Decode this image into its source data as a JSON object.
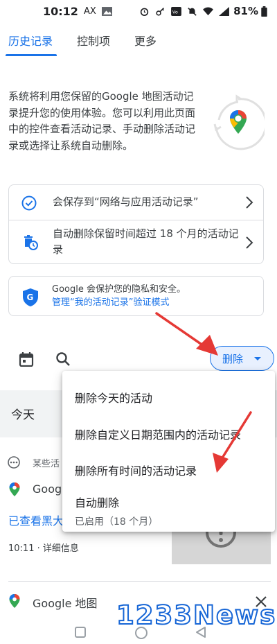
{
  "status_bar": {
    "time": "10:12",
    "ax_label": "AX",
    "battery": "81%"
  },
  "tabs": [
    {
      "label": "历史记录",
      "active": true
    },
    {
      "label": "控制项",
      "active": false
    },
    {
      "label": "更多",
      "active": false
    }
  ],
  "intro": {
    "text": "系统将利用您保留的Google 地图活动记录提升您的使用体验。您可以利用此页面中的控件查看活动记录、手动删除活动记录或选择让系统自动删除。"
  },
  "settings_card": {
    "saving_text": "会保存到“网络与应用活动记录”",
    "auto_delete_text": "自动删除保留时间超过 18 个月的活动记录"
  },
  "privacy": {
    "text": "Google 会保护您的隐私和安全。",
    "link": "管理“我的活动记录”验证模式"
  },
  "toolbar": {
    "delete_label": "删除"
  },
  "feed": {
    "today_label": "今天",
    "item_caption": "某些活",
    "app_name_partial": "Goog",
    "item_link_partial": "已查看黑大",
    "item_meta": "10:11 · 详细信息",
    "app_name": "Google 地图"
  },
  "delete_menu": {
    "items": [
      {
        "label": "删除今天的活动"
      },
      {
        "label": "删除自定义日期范围内的活动记录"
      },
      {
        "label": "删除所有时间的活动记录"
      },
      {
        "label": "自动删除",
        "sublabel": "已启用（18 个月）"
      }
    ]
  },
  "watermark": "1233News",
  "colors": {
    "accent": "#1a73e8",
    "annotation_arrow": "#e53935",
    "watermark": "#1766d6"
  }
}
